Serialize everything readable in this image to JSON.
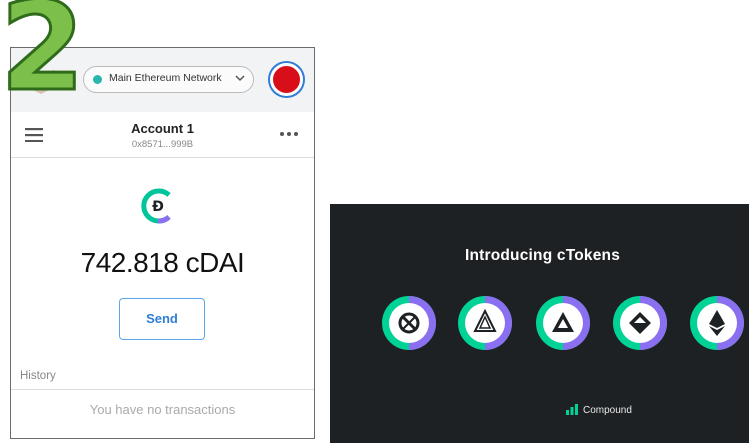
{
  "step": {
    "number": "2"
  },
  "wallet": {
    "network": {
      "label": "Main Ethereum Network",
      "dot_color": "#29b6af"
    },
    "avatar_color": "#d80f18",
    "account": {
      "name": "Account 1",
      "address": "0x8571...999B"
    },
    "balance": "742.818 cDAI",
    "send_label": "Send",
    "history": {
      "label": "History",
      "empty_text": "You have no transactions"
    }
  },
  "ctokens_panel": {
    "title": "Introducing cTokens",
    "tokens": [
      {
        "name": "ctoken-zrx-icon"
      },
      {
        "name": "ctoken-rep-icon"
      },
      {
        "name": "ctoken-bat-icon"
      },
      {
        "name": "ctoken-dai-diamond-icon"
      },
      {
        "name": "ctoken-eth-icon"
      }
    ],
    "brand": "Compound",
    "colors": {
      "background": "#1d2124",
      "accent_green": "#00d395",
      "accent_purple": "#8a6ff0"
    }
  },
  "colors": {
    "step_green": "#7cc04b",
    "link_blue": "#2f7dd6"
  }
}
